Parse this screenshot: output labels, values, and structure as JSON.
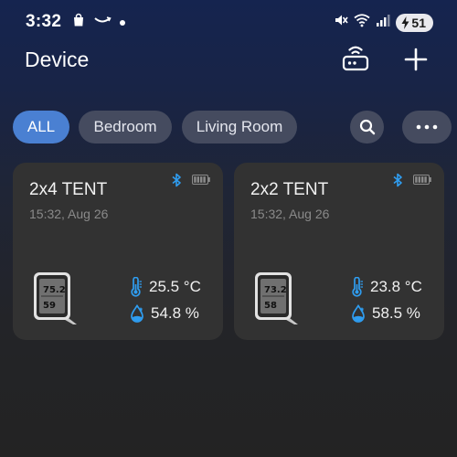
{
  "status_bar": {
    "time": "3:32",
    "battery": "51"
  },
  "header": {
    "title": "Device"
  },
  "filters": {
    "chips": [
      {
        "label": "ALL",
        "active": true
      },
      {
        "label": "Bedroom",
        "active": false
      },
      {
        "label": "Living Room",
        "active": false
      }
    ]
  },
  "devices": [
    {
      "name": "2x4 TENT",
      "updated": "15:32, Aug 26",
      "temperature": "25.5 °C",
      "humidity": "54.8 %"
    },
    {
      "name": "2x2 TENT",
      "updated": "15:32, Aug 26",
      "temperature": "23.8 °C",
      "humidity": "58.5 %"
    }
  ],
  "colors": {
    "accent": "#4a80d2",
    "icon_blue": "#2f9df0",
    "card": "#323232",
    "chip": "#454b5f"
  },
  "icons": [
    "bag-icon",
    "amazon-smile-icon",
    "notification-dot-icon",
    "mute-icon",
    "wifi-icon",
    "signal-icon",
    "charging-bolt-icon",
    "hub-router-icon",
    "plus-icon",
    "search-icon",
    "more-icon",
    "bluetooth-icon",
    "battery-icon",
    "thermometer-icon",
    "humidity-drop-icon",
    "hygrometer-device-image"
  ]
}
